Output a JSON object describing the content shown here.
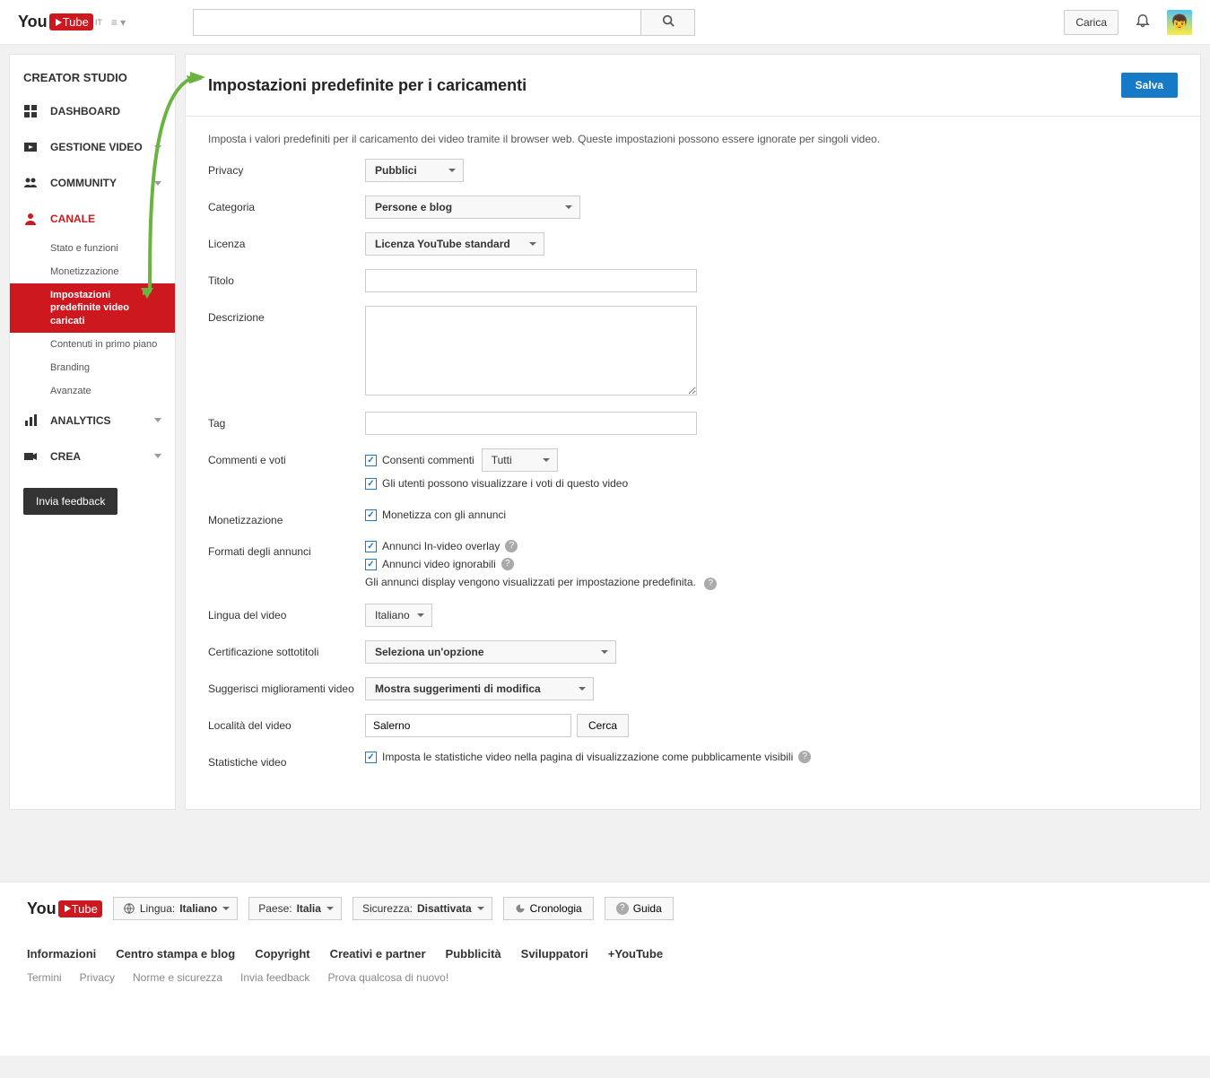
{
  "header": {
    "logo_you": "You",
    "logo_tube": "Tube",
    "locale_sup": "IT",
    "upload_label": "Carica"
  },
  "sidebar": {
    "title": "CREATOR STUDIO",
    "dashboard": "DASHBOARD",
    "gestione": "GESTIONE VIDEO",
    "community": "COMMUNITY",
    "canale": "CANALE",
    "canale_sub": {
      "stato": "Stato e funzioni",
      "monetizzazione": "Monetizzazione",
      "impostazioni": "Impostazioni predefinite video caricati",
      "contenuti": "Contenuti in primo piano",
      "branding": "Branding",
      "avanzate": "Avanzate"
    },
    "analytics": "ANALYTICS",
    "crea": "CREA",
    "feedback": "Invia feedback"
  },
  "page": {
    "title": "Impostazioni predefinite per i caricamenti",
    "save": "Salva",
    "description": "Imposta i valori predefiniti per il caricamento dei video tramite il browser web. Queste impostazioni possono essere ignorate per singoli video."
  },
  "form": {
    "privacy_label": "Privacy",
    "privacy_value": "Pubblici",
    "categoria_label": "Categoria",
    "categoria_value": "Persone e blog",
    "licenza_label": "Licenza",
    "licenza_value": "Licenza YouTube standard",
    "titolo_label": "Titolo",
    "titolo_value": "",
    "descrizione_label": "Descrizione",
    "descrizione_value": "",
    "tag_label": "Tag",
    "tag_value": "",
    "commenti_label": "Commenti e voti",
    "commenti_cb": "Consenti commenti",
    "commenti_sel": "Tutti",
    "voti_cb": "Gli utenti possono visualizzare i voti di questo video",
    "monet_label": "Monetizzazione",
    "monet_cb": "Monetizza con gli annunci",
    "formati_label": "Formati degli annunci",
    "formati_overlay": "Annunci In-video overlay",
    "formati_skip": "Annunci video ignorabili",
    "formati_note": "Gli annunci display vengono visualizzati per impostazione predefinita.",
    "lingua_label": "Lingua del video",
    "lingua_value": "Italiano",
    "cert_label": "Certificazione sottotitoli",
    "cert_value": "Seleziona un'opzione",
    "sugg_label": "Suggerisci miglioramenti video",
    "sugg_value": "Mostra suggerimenti di modifica",
    "loc_label": "Località del video",
    "loc_value": "Salerno",
    "cerca": "Cerca",
    "stat_label": "Statistiche video",
    "stat_cb": "Imposta le statistiche video nella pagina di visualizzazione come pubblicamente visibili"
  },
  "footer": {
    "lingua_prefix": "Lingua: ",
    "lingua": "Italiano",
    "paese_prefix": "Paese: ",
    "paese": "Italia",
    "sicur_prefix": "Sicurezza: ",
    "sicur": "Disattivata",
    "cronologia": "Cronologia",
    "guida": "Guida",
    "links": {
      "info": "Informazioni",
      "centro": "Centro stampa e blog",
      "copy": "Copyright",
      "creativi": "Creativi e partner",
      "pubb": "Pubblicità",
      "svil": "Sviluppatori",
      "plus": "+YouTube"
    },
    "links2": {
      "termini": "Termini",
      "privacy": "Privacy",
      "norme": "Norme e sicurezza",
      "feedback": "Invia feedback",
      "prova": "Prova qualcosa di nuovo!"
    }
  }
}
